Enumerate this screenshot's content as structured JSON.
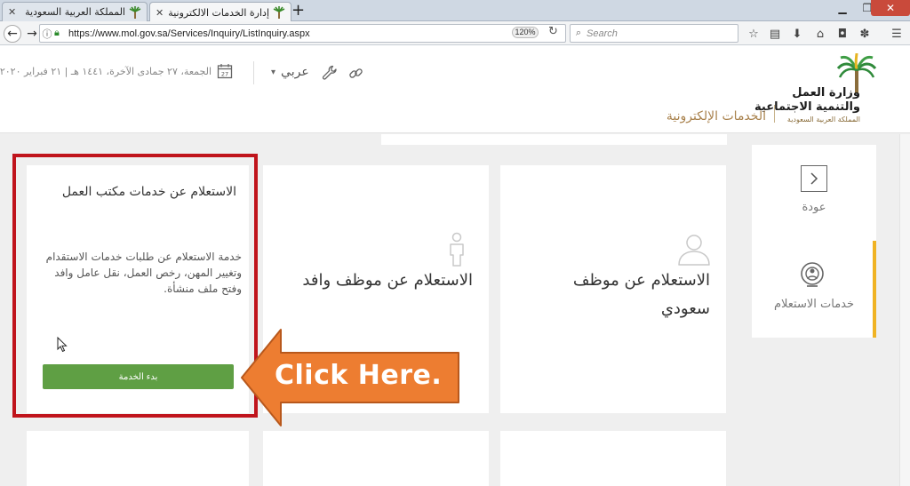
{
  "browser": {
    "tabs": [
      {
        "title": "المملكة العربية السعودية | وزارة",
        "active": false
      },
      {
        "title": "إدارة الخدمات الالكترونية لوزارة ال",
        "active": true
      }
    ],
    "close_glyph": "✕",
    "new_tab_glyph": "+",
    "url": "https://www.mol.gov.sa/Services/Inquiry/ListInquiry.aspx",
    "zoom": "120%",
    "search_placeholder": "Search"
  },
  "header": {
    "logo_line1": "وزارة العمل",
    "logo_line2": "والتنمية الاجتماعية",
    "logo_line3": "المملكة العربية السعودية",
    "eservices": "الخدمات الإلكترونية",
    "date": "الجمعة، ٢٧ جمادى الآخرة، ١٤٤١ هـ | ٢١ فبراير ٢٠٢٠",
    "calendar_day": "27",
    "language": "عربي"
  },
  "cards": {
    "office": {
      "title": "الاستعلام عن خدمات مكتب العمل",
      "description": "خدمة الاستعلام عن طلبات خدمات الاستقدام وتغيير المهن، رخص العمل، نقل عامل وافد وفتح ملف منشأة.",
      "button": "بدء الخدمة"
    },
    "expat": {
      "title": "الاستعلام عن موظف وافد"
    },
    "saudi": {
      "title": "الاستعلام عن موظف سعودي"
    }
  },
  "sidebar": {
    "back": "عودة",
    "inquiry": "خدمات الاستعلام"
  },
  "annotation": {
    "callout": "Click Here.",
    "arrow_color": "#ed7d31",
    "highlight_color": "#c0141c"
  },
  "colors": {
    "primary_green": "#5f9f44",
    "gold": "#a9824d",
    "accent_yellow": "#f0b323"
  }
}
